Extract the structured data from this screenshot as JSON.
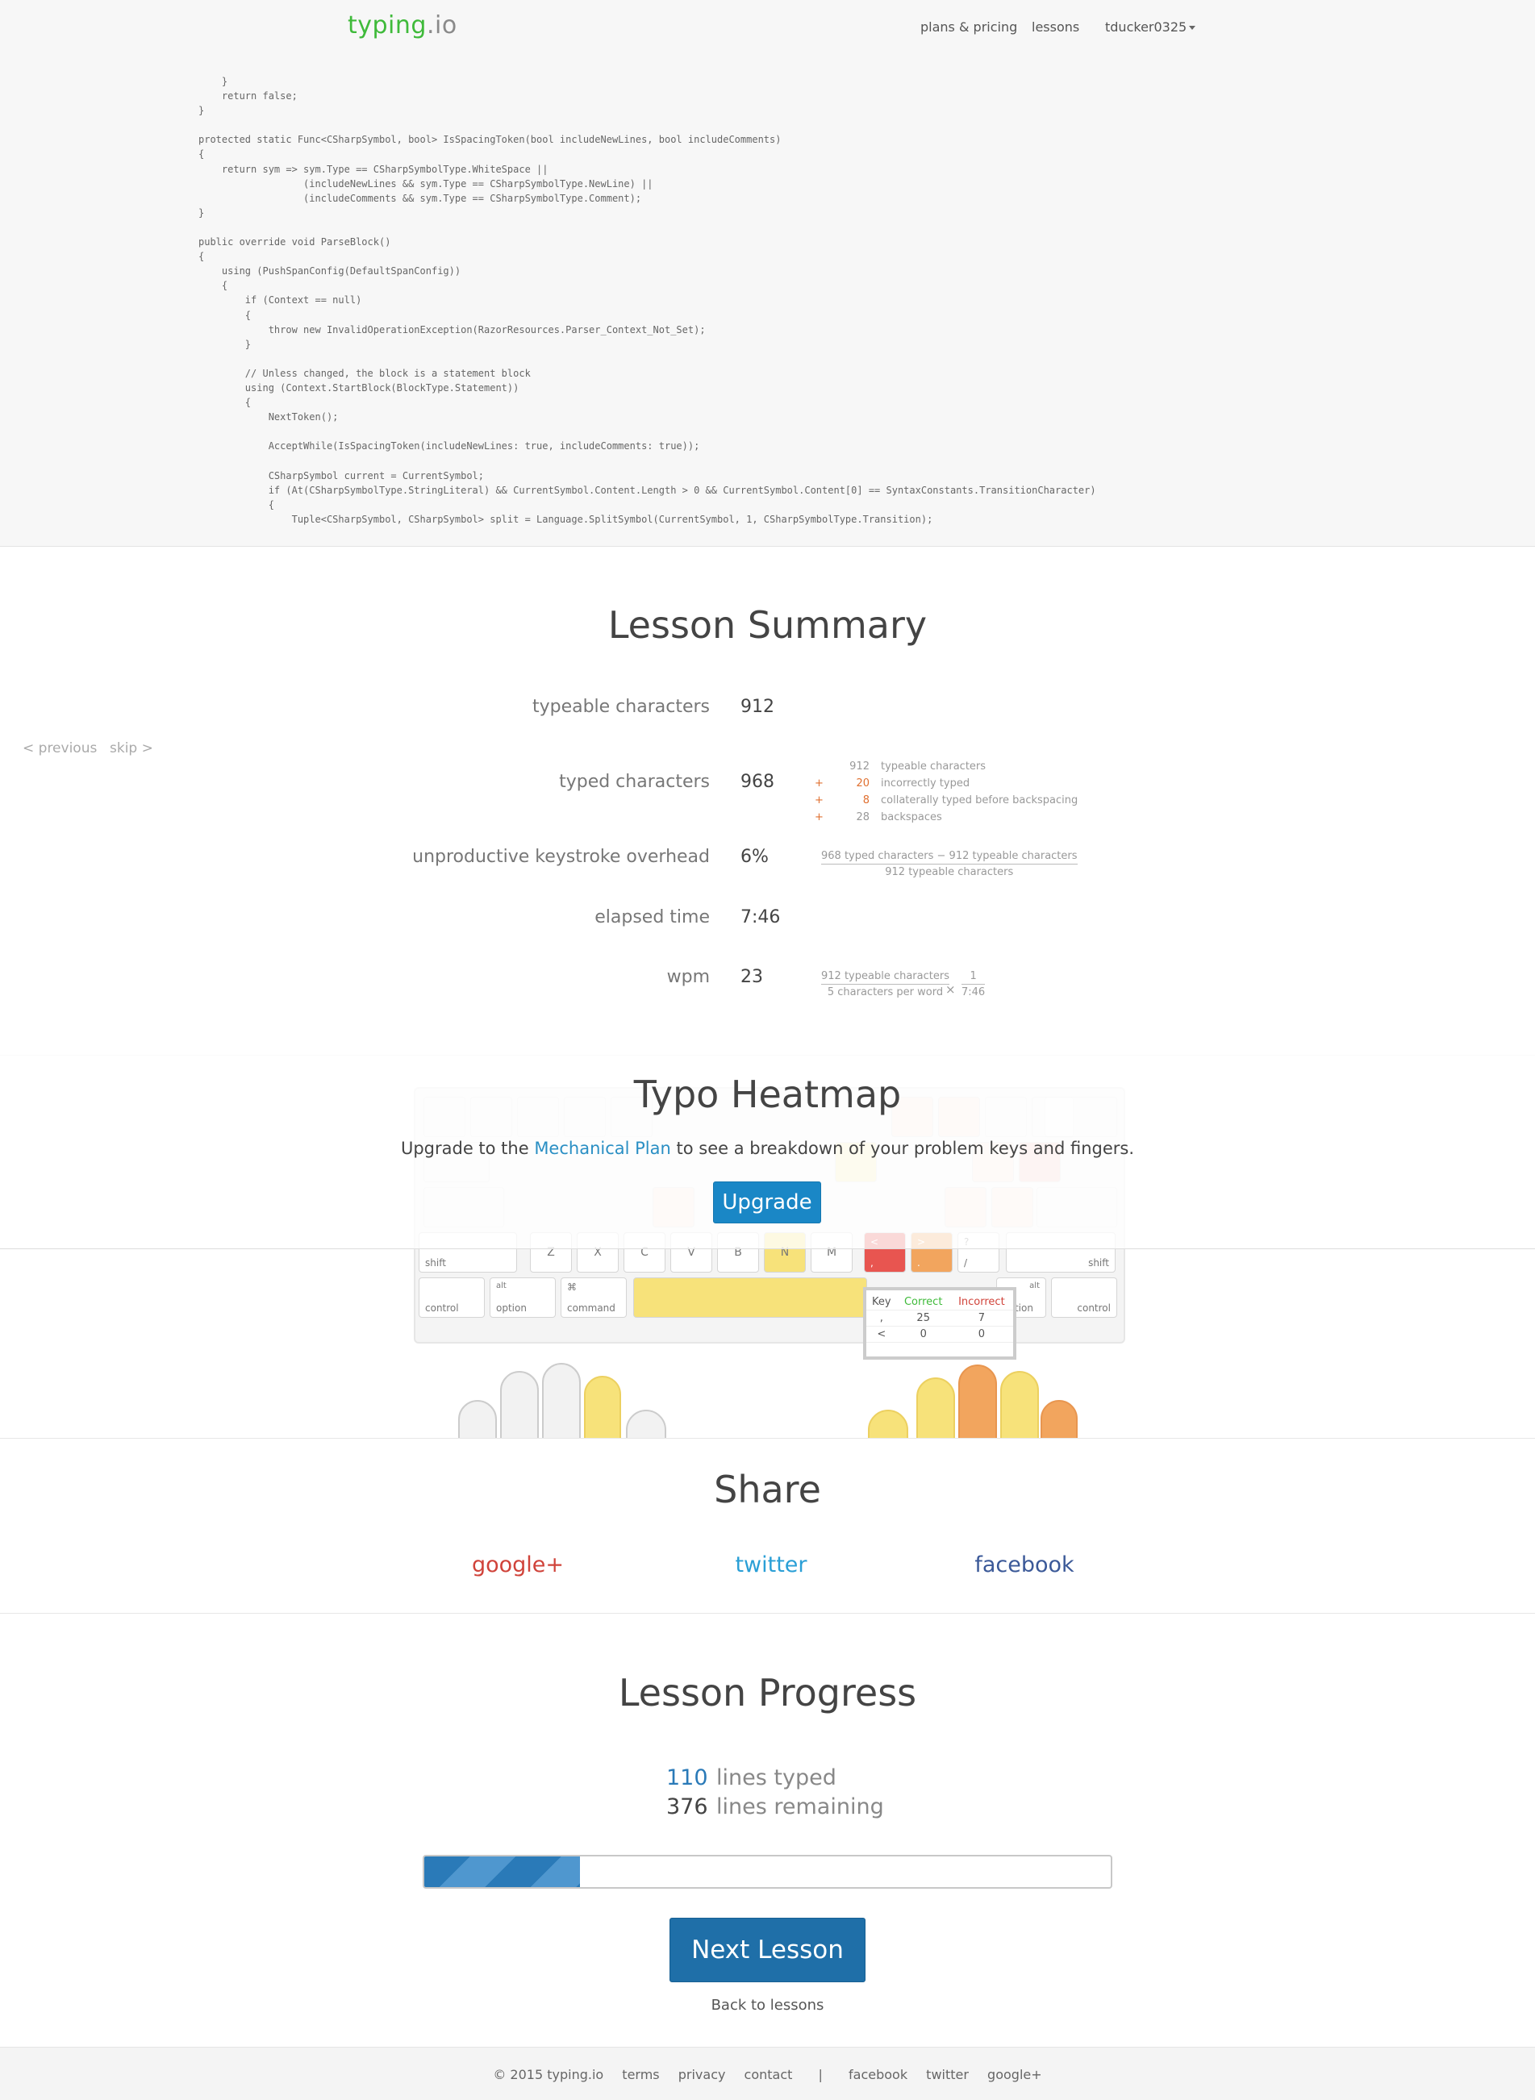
{
  "header": {
    "logo_main": "typing",
    "logo_ext": ".io",
    "nav": {
      "plans": "plans & pricing",
      "lessons": "lessons",
      "user": "tducker0325"
    }
  },
  "code_lines": [
    "    }",
    "    return false;",
    "}",
    "",
    "protected static Func<CSharpSymbol, bool> IsSpacingToken(bool includeNewLines, bool includeComments)",
    "{",
    "    return sym => sym.Type == CSharpSymbolType.WhiteSpace ||",
    "                  (includeNewLines && sym.Type == CSharpSymbolType.NewLine) ||",
    "                  (includeComments && sym.Type == CSharpSymbolType.Comment);",
    "}",
    "",
    "public override void ParseBlock()",
    "{",
    "    using (PushSpanConfig(DefaultSpanConfig))",
    "    {",
    "        if (Context == null)",
    "        {",
    "            throw new InvalidOperationException(RazorResources.Parser_Context_Not_Set);",
    "        }",
    "",
    "        // Unless changed, the block is a statement block",
    "        using (Context.StartBlock(BlockType.Statement))",
    "        {",
    "            NextToken();",
    "",
    "            AcceptWhile(IsSpacingToken(includeNewLines: true, includeComments: true));",
    "",
    "            CSharpSymbol current = CurrentSymbol;",
    "            if (At(CSharpSymbolType.StringLiteral) && CurrentSymbol.Content.Length > 0 && CurrentSymbol.Content[0] == SyntaxConstants.TransitionCharacter)",
    "            {",
    "                Tuple<CSharpSymbol, CSharpSymbol> split = Language.SplitSymbol(CurrentSymbol, 1, CSharpSymbolType.Transition);"
  ],
  "summary": {
    "title": "Lesson Summary",
    "previous": "< previous",
    "skip": "skip >",
    "rows": {
      "typeable": {
        "label": "typeable characters",
        "value": "912"
      },
      "typed": {
        "label": "typed characters",
        "value": "968"
      },
      "overhead": {
        "label": "unproductive keystroke overhead",
        "value": "6%"
      },
      "elapsed": {
        "label": "elapsed time",
        "value": "7:46"
      },
      "wpm": {
        "label": "wpm",
        "value": "23"
      }
    },
    "breakdown": [
      {
        "op": "",
        "num": "912",
        "text": "typeable characters"
      },
      {
        "op": "+",
        "num": "20",
        "text": "incorrectly typed"
      },
      {
        "op": "+",
        "num": "8",
        "text": "collaterally typed before backspacing"
      },
      {
        "op": "+",
        "num": "28",
        "text": "backspaces"
      }
    ],
    "overhead_formula": {
      "top": "968 typed characters − 912 typeable characters",
      "bottom": "912 typeable characters"
    },
    "wpm_formula": {
      "left_top": "912 typeable characters",
      "left_bottom": "5 characters per word",
      "times": "×",
      "right_top": "1",
      "right_bottom": "7:46"
    }
  },
  "heatmap": {
    "title": "Typo Heatmap",
    "sub_pre": "Upgrade to the ",
    "sub_link": "Mechanical Plan",
    "sub_post": " to see a breakdown of your problem keys and fingers.",
    "upgrade_label": "Upgrade",
    "colors": {
      "yellow": "#f7e27a",
      "orange": "#f2a55e",
      "red": "#e85550",
      "light": "#fbe3d2"
    },
    "keys": {
      "shift_left": "shift",
      "z": "Z",
      "x": "X",
      "c": "C",
      "v": "V",
      "b": "B",
      "n": "N",
      "m": "M",
      "comma_top": "<",
      "comma_bot": ",",
      "period_top": ">",
      "period_bot": ".",
      "slash_top": "?",
      "slash_bot": "/",
      "shift_right": "shift",
      "control_left": "control",
      "option_left_top": "alt",
      "option_left_bot": "option",
      "command_left_top": "⌘",
      "command_left_bot": "command",
      "option_right_top": "alt",
      "option_right_bot": "option",
      "control_right": "control"
    },
    "tooltip": {
      "headers": [
        "Key",
        "Correct",
        "Incorrect"
      ],
      "rows": [
        [
          ",",
          "25",
          "7"
        ],
        [
          "<",
          "0",
          "0"
        ]
      ]
    }
  },
  "share": {
    "title": "Share",
    "google": "google+",
    "twitter": "twitter",
    "facebook": "facebook",
    "colors": {
      "google": "#d0433a",
      "twitter": "#2a9fd6",
      "facebook": "#3b5998"
    }
  },
  "progress": {
    "title": "Lesson Progress",
    "typed_num": "110",
    "typed_label": "lines typed",
    "remaining_num": "376",
    "remaining_label": "lines remaining",
    "fraction": 0.2263,
    "next_label": "Next Lesson",
    "back_label": "Back to lessons"
  },
  "footer": {
    "copyright": "© 2015 typing.io",
    "terms": "terms",
    "privacy": "privacy",
    "contact": "contact",
    "sep": "|",
    "facebook": "facebook",
    "twitter": "twitter",
    "google": "google+"
  }
}
